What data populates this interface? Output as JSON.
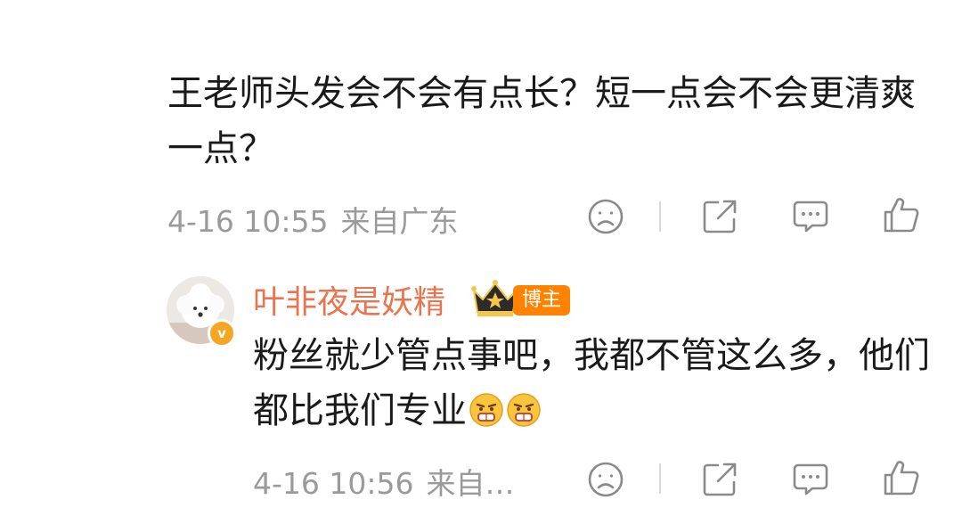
{
  "comments": [
    {
      "text": "王老师头发会不会有点长？短一点会不会更清爽一点？",
      "date": "4-16 10:55",
      "location": "来自广东"
    },
    {
      "username": "叶非夜是妖精",
      "badge": "博主",
      "verified_mark": "v",
      "text": "粉丝就少管点事吧，我都不管这么多，他们都比我们专业",
      "emoji": [
        "grimace-emoji",
        "grimace-emoji"
      ],
      "date": "4-16 10:56",
      "location": "来自…"
    }
  ],
  "actions": [
    "dislike-icon",
    "share-icon",
    "comment-icon",
    "like-icon"
  ],
  "colors": {
    "text": "#1a1a1a",
    "meta": "#9a9a9a",
    "username": "#eb7350",
    "badge": "#ff8200",
    "icon": "#8a8a8a"
  }
}
